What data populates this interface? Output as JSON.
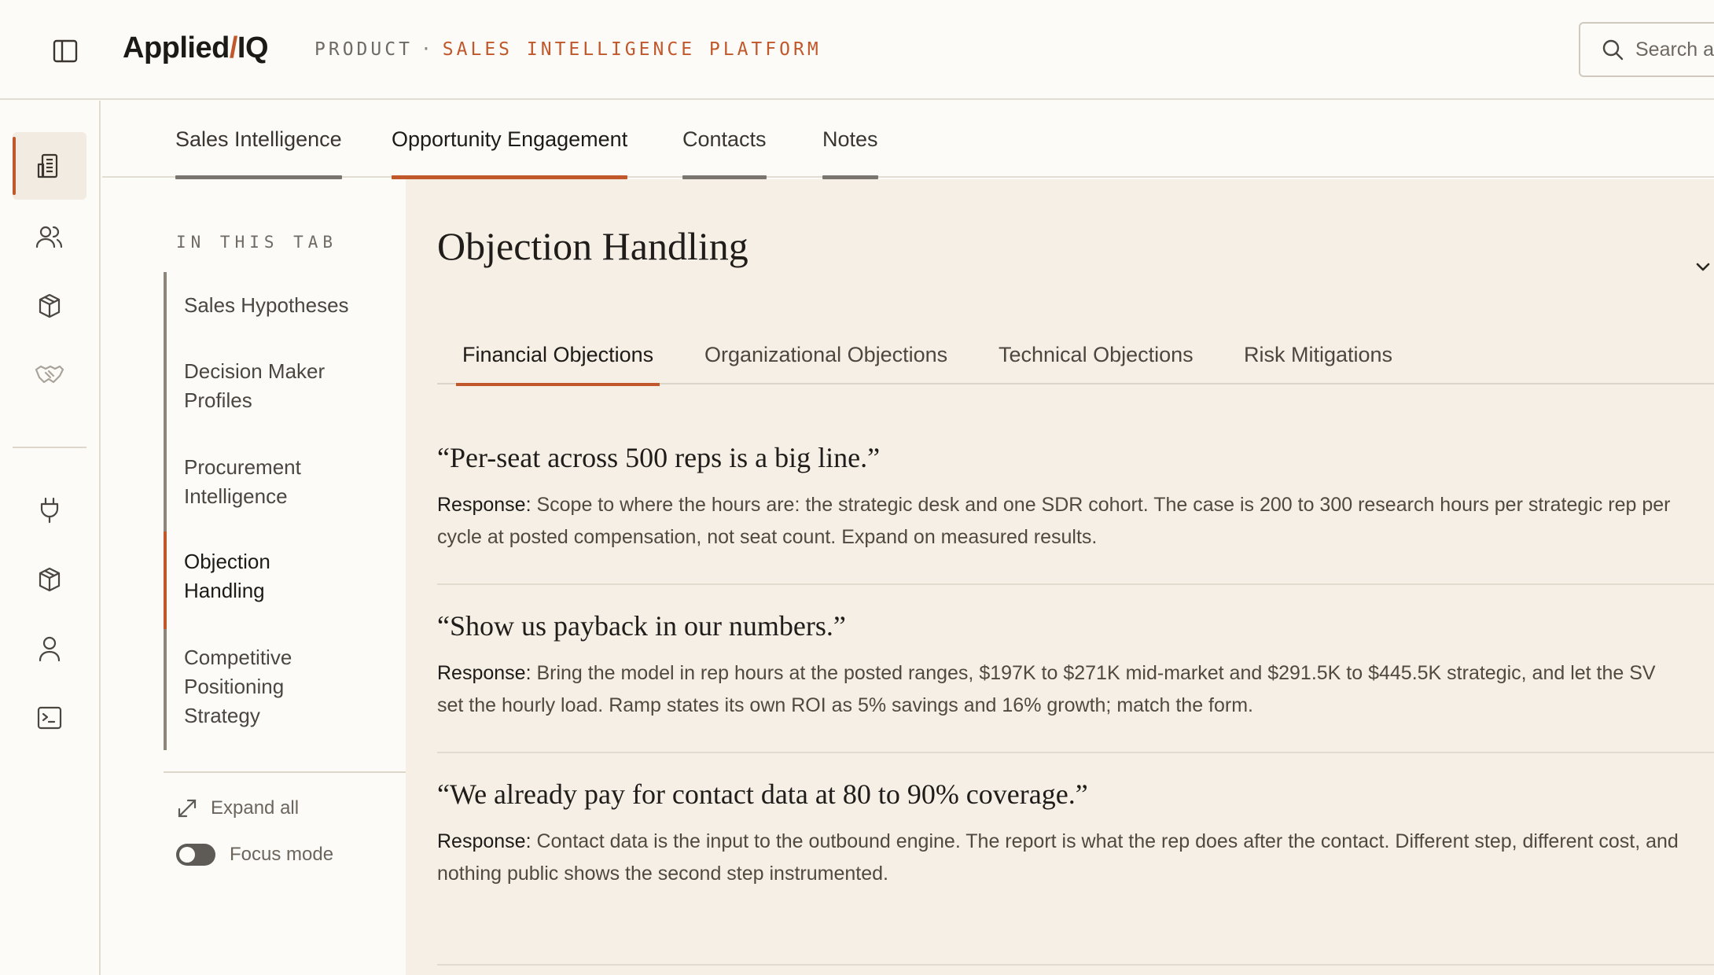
{
  "header": {
    "logo_main": "Applied",
    "logo_slash": "/",
    "logo_suffix": "IQ",
    "crumb_product": "PRODUCT",
    "crumb_sep": "·",
    "crumb_platform": "SALES INTELLIGENCE PLATFORM",
    "search_placeholder": "Search ac"
  },
  "rail": {
    "items": [
      {
        "icon": "building-icon",
        "active": true
      },
      {
        "icon": "users-icon"
      },
      {
        "icon": "box-icon"
      },
      {
        "icon": "handshake-icon"
      },
      {
        "icon": "plug-icon"
      },
      {
        "icon": "box-icon"
      },
      {
        "icon": "user-icon"
      },
      {
        "icon": "terminal-icon"
      }
    ]
  },
  "tabs": [
    {
      "label": "Sales Intelligence"
    },
    {
      "label": "Opportunity Engagement",
      "active": true
    },
    {
      "label": "Contacts"
    },
    {
      "label": "Notes"
    }
  ],
  "sidenav": {
    "heading": "IN THIS TAB",
    "items": [
      {
        "line1": "Sales Hypotheses",
        "line2": "",
        "line3": ""
      },
      {
        "line1": "Decision Maker",
        "line2": "Profiles",
        "line3": ""
      },
      {
        "line1": "Procurement",
        "line2": "Intelligence",
        "line3": ""
      },
      {
        "line1": "Objection",
        "line2": "Handling",
        "line3": "",
        "active": true
      },
      {
        "line1": "Competitive",
        "line2": "Positioning",
        "line3": "Strategy"
      }
    ],
    "expand_all": "Expand all",
    "focus_mode": "Focus mode"
  },
  "content": {
    "title": "Objection Handling",
    "subtabs": [
      {
        "label": "Financial Objections",
        "active": true
      },
      {
        "label": "Organizational Objections"
      },
      {
        "label": "Technical Objections"
      },
      {
        "label": "Risk Mitigations"
      }
    ],
    "objections": [
      {
        "quote": "“Per-seat across 500 reps is a big line.”",
        "label": "Response:",
        "line1": " Scope to where the hours are: the strategic desk and one SDR cohort. The case is 200 to 300 research hours per strategic rep per",
        "line2": "cycle at posted compensation, not seat count. Expand on measured results."
      },
      {
        "quote": "“Show us payback in our numbers.”",
        "label": "Response:",
        "line1": " Bring the model in rep hours at the posted ranges, $197K to $271K mid-market and $291.5K to $445.5K strategic, and let the SV",
        "line2": "set the hourly load. Ramp states its own ROI as 5% savings and 16% growth; match the form."
      },
      {
        "quote": "“We already pay for contact data at 80 to 90% coverage.”",
        "label": "Response:",
        "line1": " Contact data is the input to the outbound engine. The report is what the rep does after the contact. Different step, different cost, and",
        "line2": "nothing public shows the second step instrumented."
      }
    ]
  },
  "colors": {
    "accent": "#c0582c",
    "background": "#fcfbf7",
    "panel": "#f5efe6"
  }
}
